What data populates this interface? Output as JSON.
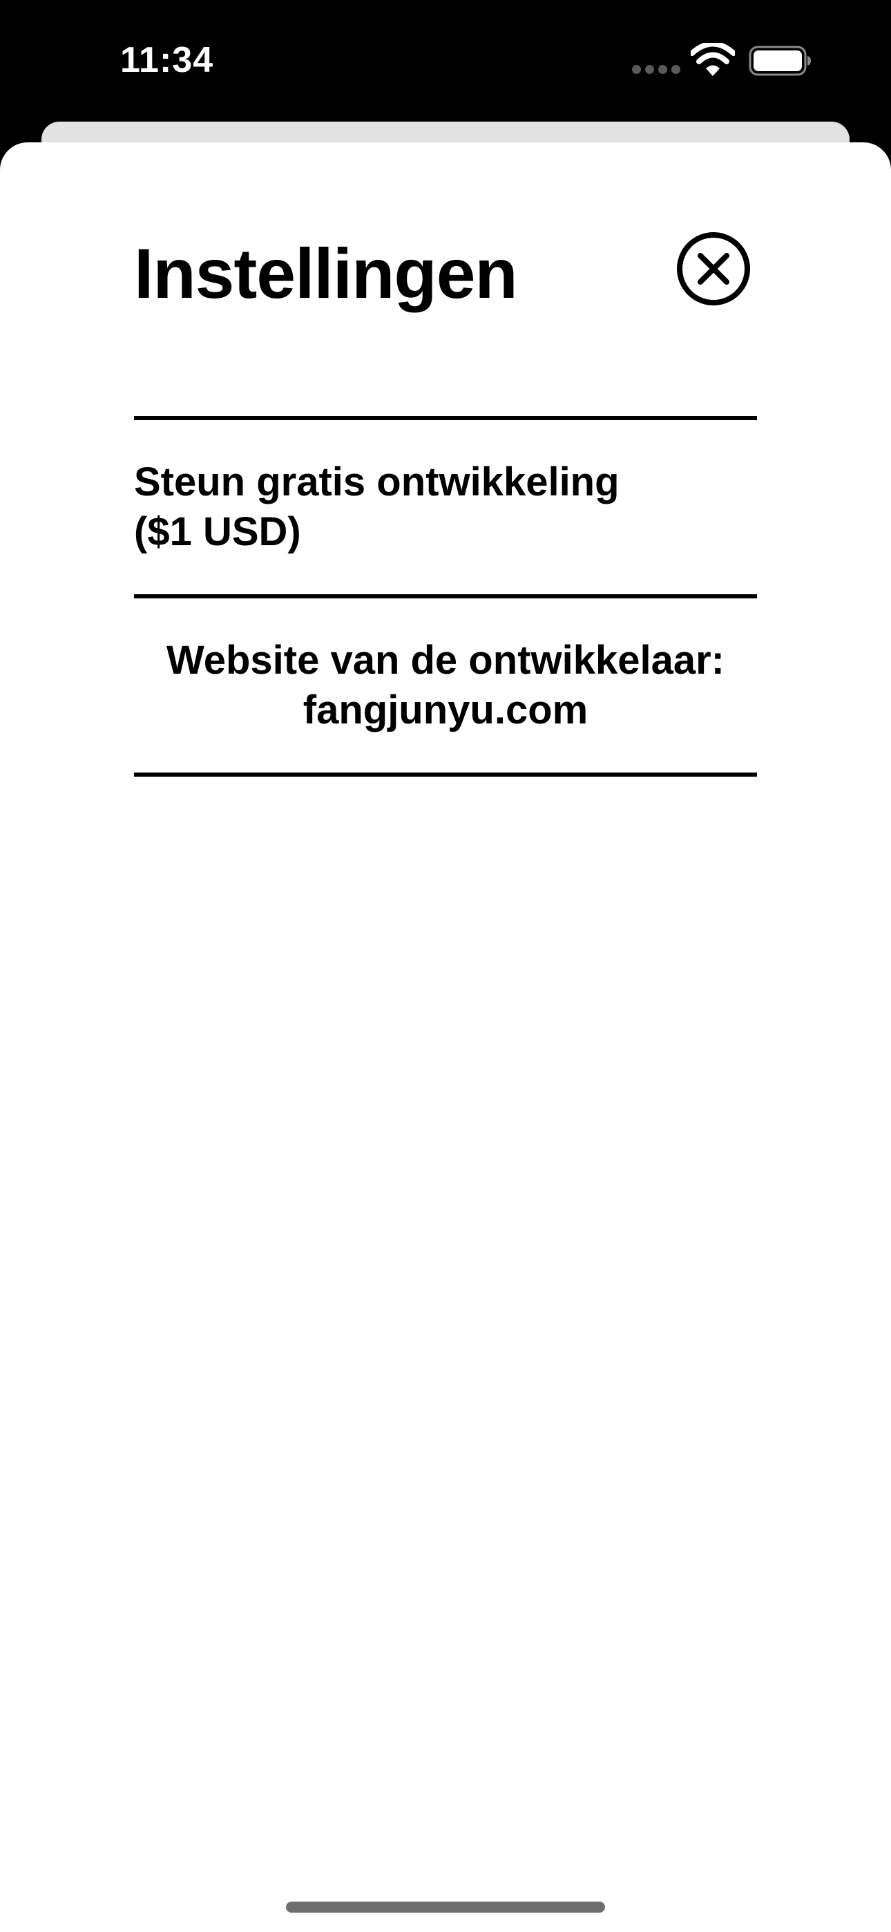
{
  "status_bar": {
    "time": "11:34",
    "icons": [
      "cellular-signal-icon",
      "wifi-icon",
      "battery-icon"
    ]
  },
  "sheet": {
    "title": "Instellingen",
    "close_icon": "close-circle-icon",
    "items": [
      {
        "line1": "Steun gratis ontwikkeling",
        "line2": "($1 USD)"
      },
      {
        "line1": "Website van de ontwikkelaar:",
        "line2": "fangjunyu.com"
      }
    ]
  },
  "colors": {
    "background": "#000000",
    "sheet": "#ffffff",
    "text": "#000000",
    "back_card": "#e2e2e2"
  }
}
